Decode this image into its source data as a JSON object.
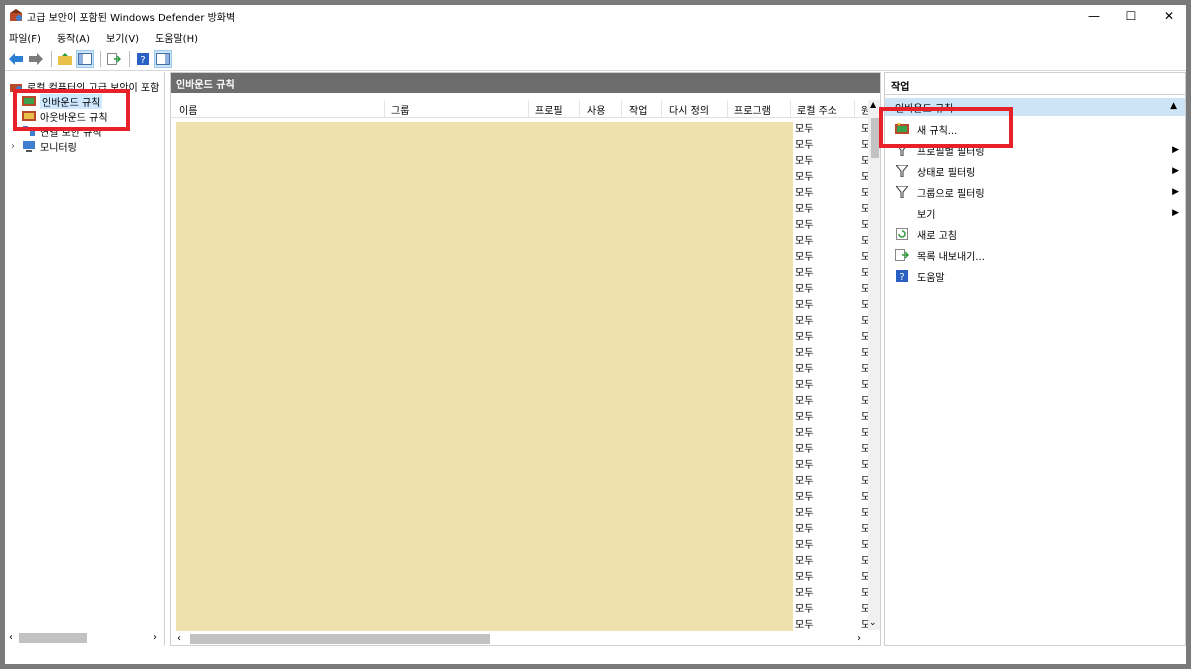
{
  "window": {
    "title": "고급 보안이 포함된 Windows Defender 방화벽",
    "min": "—",
    "max": "☐",
    "close": "✕"
  },
  "menu": [
    "파일(F)",
    "동작(A)",
    "보기(V)",
    "도움말(H)"
  ],
  "tree": {
    "root": "로컬 컴퓨터의 고급 보안이 포함",
    "inbound": "인바운드 규칙",
    "outbound": "아웃바운드 규칙",
    "connection": "연결 보안 규칙",
    "monitoring": "모니터링"
  },
  "list": {
    "title": "인바운드 규칙",
    "columns": [
      "이름",
      "그룹",
      "프로필",
      "사용",
      "작업",
      "다시 정의",
      "프로그램",
      "로컬 주소",
      "원"
    ],
    "rows": [
      [
        "모두",
        "모"
      ],
      [
        "모두",
        "모"
      ],
      [
        "모두",
        "모"
      ],
      [
        "모두",
        "모"
      ],
      [
        "모두",
        "모"
      ],
      [
        "모두",
        "모"
      ],
      [
        "모두",
        "모"
      ],
      [
        "모두",
        "모"
      ],
      [
        "모두",
        "모"
      ],
      [
        "모두",
        "모"
      ],
      [
        "모두",
        "모"
      ],
      [
        "모두",
        "모"
      ],
      [
        "모두",
        "모"
      ],
      [
        "모두",
        "모"
      ],
      [
        "모두",
        "모"
      ],
      [
        "모두",
        "모"
      ],
      [
        "모두",
        "모"
      ],
      [
        "모두",
        "모"
      ],
      [
        "모두",
        "모"
      ],
      [
        "모두",
        "모"
      ],
      [
        "모두",
        "모"
      ],
      [
        "모두",
        "모"
      ],
      [
        "모두",
        "모"
      ],
      [
        "모두",
        "모"
      ],
      [
        "모두",
        "모"
      ],
      [
        "모두",
        "모"
      ],
      [
        "모두",
        "모"
      ],
      [
        "모두",
        "모"
      ],
      [
        "모두",
        "모"
      ],
      [
        "모두",
        "모"
      ],
      [
        "모두",
        "모"
      ],
      [
        "모두",
        "모"
      ]
    ]
  },
  "actions": {
    "title": "작업",
    "group": "인바운드 규칙",
    "items": [
      {
        "label": "새 규칙...",
        "icon": "new-rule-icon",
        "arrow": false
      },
      {
        "label": "프로필별 필터링",
        "icon": "filter-icon",
        "arrow": true
      },
      {
        "label": "상태로 필터링",
        "icon": "filter-icon",
        "arrow": true
      },
      {
        "label": "그룹으로 필터링",
        "icon": "filter-icon",
        "arrow": true
      },
      {
        "label": "보기",
        "icon": "",
        "arrow": true
      },
      {
        "label": "새로 고침",
        "icon": "refresh-icon",
        "arrow": false
      },
      {
        "label": "목록 내보내기...",
        "icon": "export-icon",
        "arrow": false
      },
      {
        "label": "도움말",
        "icon": "help-icon",
        "arrow": false
      }
    ]
  },
  "colors": {
    "highlight": "#e8202a",
    "mask": "#efe1ae",
    "header": "#6d6d6d",
    "selection": "#cde4f6"
  }
}
